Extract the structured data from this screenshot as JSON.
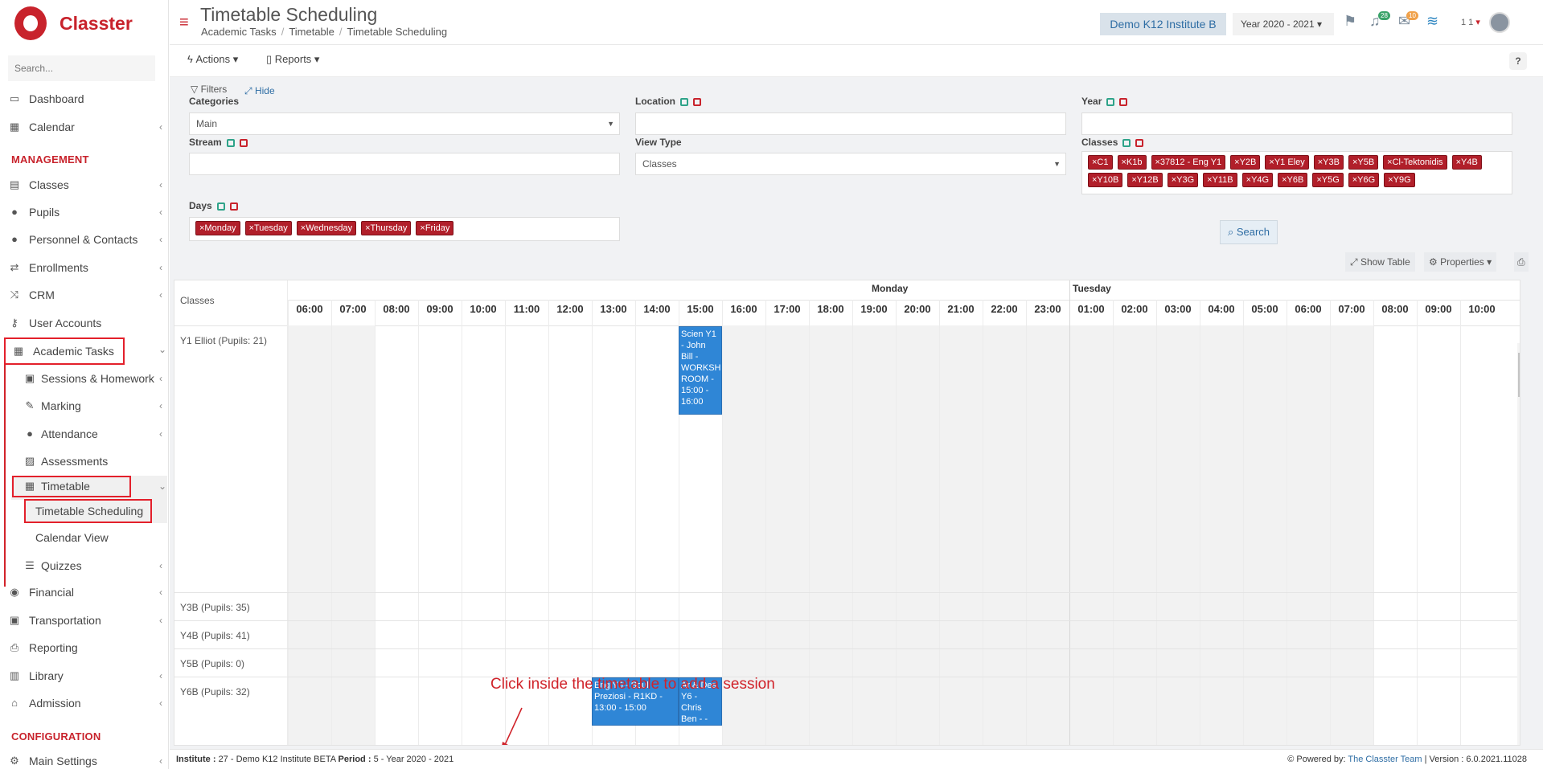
{
  "app": {
    "brand": "Classter",
    "search_placeholder": "Search..."
  },
  "colors": {
    "brand": "#c8232c",
    "accent": "#2e6da4",
    "event": "#2f86d6",
    "tag": "#b11f2a"
  },
  "sidebar": {
    "items": [
      {
        "label": "Dashboard",
        "icon": "laptop-icon"
      },
      {
        "label": "Calendar",
        "icon": "calendar-icon"
      },
      {
        "label": "Classes",
        "icon": "grid-icon"
      },
      {
        "label": "Pupils",
        "icon": "users-icon"
      },
      {
        "label": "Personnel & Contacts",
        "icon": "person-icon"
      },
      {
        "label": "Enrollments",
        "icon": "exchange-icon"
      },
      {
        "label": "CRM",
        "icon": "shuffle-icon"
      },
      {
        "label": "User Accounts",
        "icon": "key-icon"
      },
      {
        "label": "Academic Tasks",
        "icon": "tiles-icon"
      },
      {
        "label": "Sessions & Homework",
        "icon": "presentation-icon"
      },
      {
        "label": "Marking",
        "icon": "edit-icon"
      },
      {
        "label": "Attendance",
        "icon": "user-check-icon"
      },
      {
        "label": "Assessments",
        "icon": "pencil-square-icon"
      },
      {
        "label": "Timetable",
        "icon": "calendar-icon"
      },
      {
        "label": "Timetable Scheduling",
        "icon": ""
      },
      {
        "label": "Calendar View",
        "icon": ""
      },
      {
        "label": "Quizzes",
        "icon": "list-icon"
      },
      {
        "label": "Financial",
        "icon": "coins-icon"
      },
      {
        "label": "Transportation",
        "icon": "bus-icon"
      },
      {
        "label": "Reporting",
        "icon": "printer-icon"
      },
      {
        "label": "Library",
        "icon": "books-icon"
      },
      {
        "label": "Admission",
        "icon": "building-icon"
      },
      {
        "label": "Main Settings",
        "icon": "gear-icon"
      }
    ],
    "section_management": "MANAGEMENT",
    "section_configuration": "CONFIGURATION"
  },
  "header": {
    "title": "Timetable Scheduling",
    "breadcrumb": [
      "Academic Tasks",
      "Timetable",
      "Timetable Scheduling"
    ],
    "institute": "Demo K12 Institute B",
    "year": "Year 2020 - 2021",
    "notif_count": "28",
    "mail_count": "10",
    "user_short": "1 1"
  },
  "actions": {
    "actions_label": "Actions",
    "reports_label": "Reports",
    "help": "?"
  },
  "filters": {
    "title": "Filters",
    "hide": "Hide",
    "categories_label": "Categories",
    "categories_value": "Main",
    "location_label": "Location",
    "year_label": "Year",
    "stream_label": "Stream",
    "view_type_label": "View Type",
    "view_type_value": "Classes",
    "classes_label": "Classes",
    "classes_tags": [
      "×C1",
      "×K1b",
      "×37812 - Eng Y1",
      "×Y2B",
      "×Y1 Eley",
      "×Y3B",
      "×Y5B",
      "×Cl-Tektonidis",
      "×Y4B",
      "×Y10B",
      "×Y12B",
      "×Y3G",
      "×Y11B",
      "×Y4G",
      "×Y6B",
      "×Y5G",
      "×Y6G",
      "×Y9G"
    ],
    "days_label": "Days",
    "days_tags": [
      "×Monday",
      "×Tuesday",
      "×Wednesday",
      "×Thursday",
      "×Friday"
    ],
    "search_btn": "Search"
  },
  "toolbar": {
    "show_table": "Show Table",
    "properties": "Properties"
  },
  "timetable": {
    "col_header": "Classes",
    "days": [
      "Monday",
      "Tuesday"
    ],
    "hours": [
      "06:00",
      "07:00",
      "08:00",
      "09:00",
      "10:00",
      "11:00",
      "12:00",
      "13:00",
      "14:00",
      "15:00",
      "16:00",
      "17:00",
      "18:00",
      "19:00",
      "20:00",
      "21:00",
      "22:00",
      "23:00",
      "01:00",
      "02:00",
      "03:00",
      "04:00",
      "05:00",
      "06:00",
      "07:00",
      "08:00",
      "09:00",
      "10:00"
    ],
    "rows": [
      "Y1 Elliot (Pupils: 21)",
      "Y3B (Pupils: 35)",
      "Y4B (Pupils: 41)",
      "Y5B (Pupils: 0)",
      "Y6B (Pupils: 32)"
    ],
    "events": [
      {
        "text": "Scien Y1 - John Bill - WORKSHOP ROOM - 15:00 - 16:00"
      },
      {
        "text": "Eng Y6 - Soul Preziosi - R1KD - 13:00 - 15:00"
      },
      {
        "text": "Ar & Des Y6 - Chris Ben - -"
      }
    ]
  },
  "annotation": "Click inside the timetable to add a session",
  "footer": {
    "institute_label": "Institute :",
    "institute_value": "27 - Demo K12 Institute BETA",
    "period_label": "Period :",
    "period_value": "5 - Year 2020 - 2021",
    "powered": "Powered by:",
    "team": "The Classter Team",
    "version": "| Version : 6.0.2021.11028"
  }
}
